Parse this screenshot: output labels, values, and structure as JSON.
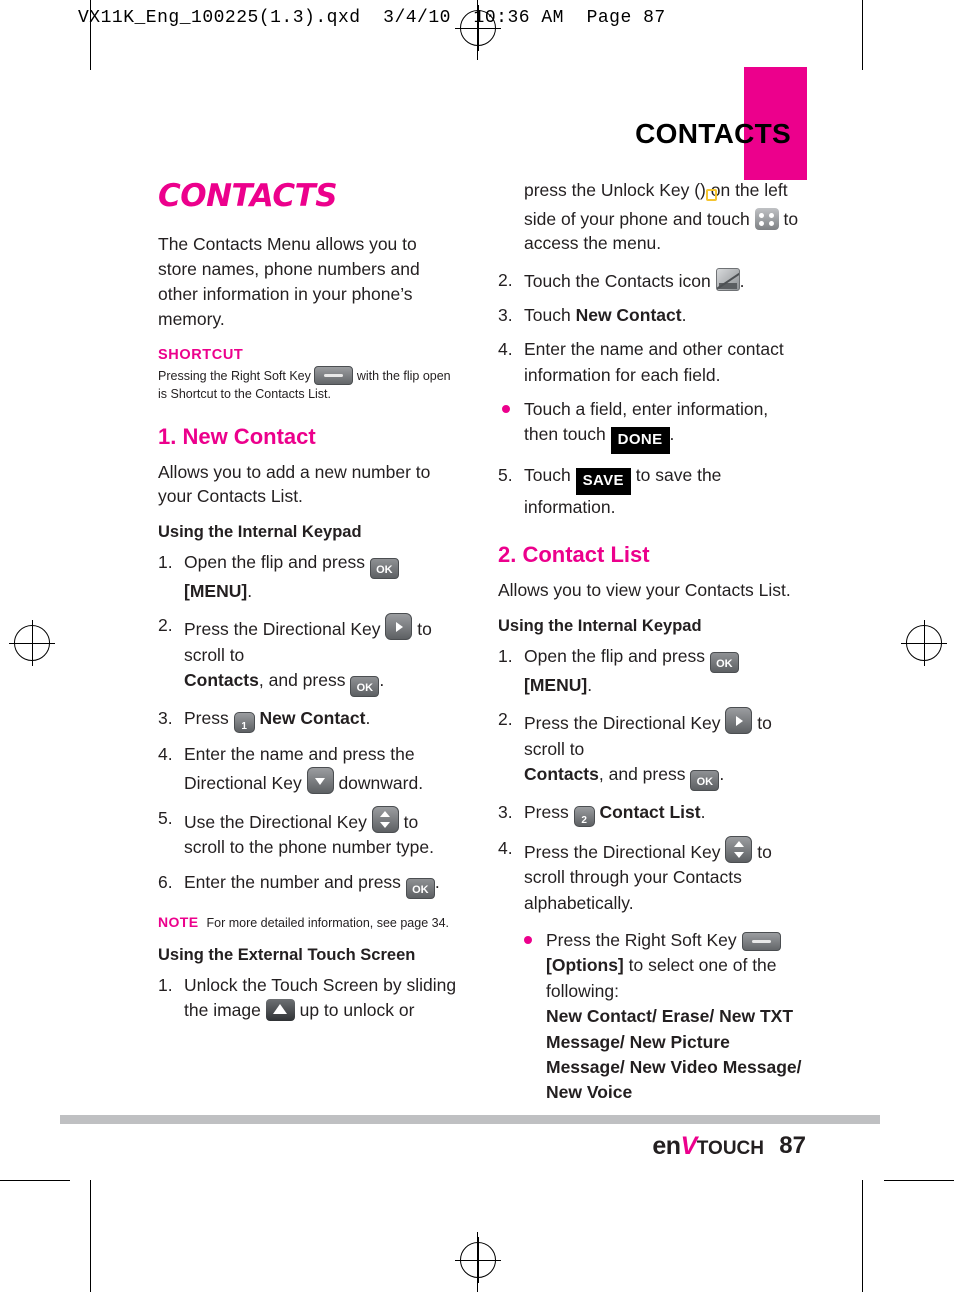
{
  "meta": {
    "slug": "VX11K_Eng_100225(1.3).qxd  3/4/10  10:36 AM  Page 87",
    "running_head": "CONTACTS",
    "page_number": "87",
    "brand": "enV",
    "brand_suffix": "TOUCH",
    "accent_color": "#ec008c"
  },
  "left_column": {
    "chapter_title": "CONTACTS",
    "intro": "The Contacts Menu allows you to store names, phone numbers and other information in your phone’s memory.",
    "shortcut_heading": "SHORTCUT",
    "shortcut_text_a": "Pressing the Right Soft Key",
    "shortcut_text_b": "with the flip open is Shortcut to the Contacts List.",
    "section1_title": "1. New Contact",
    "section1_body": "Allows you to add a new number to your Contacts List.",
    "internal_keypad_heading": "Using the Internal Keypad",
    "steps": [
      {
        "num": "1.",
        "a": "Open the flip and press",
        "b": "[MENU]",
        "c": "."
      },
      {
        "num": "2.",
        "a": "Press the Directional Key",
        "b": "to scroll to",
        "c": "Contacts",
        "d": ", and press",
        "e": "."
      },
      {
        "num": "3.",
        "a": "Press",
        "b": "New Contact",
        "c": "."
      },
      {
        "num": "4.",
        "a": "Enter the name and press the Directional Key",
        "b": "downward."
      },
      {
        "num": "5.",
        "a": "Use the Directional Key",
        "b": "to scroll to the phone number type."
      },
      {
        "num": "6.",
        "a": "Enter the number and press",
        "b": "."
      }
    ],
    "note_label": "NOTE",
    "note_text": "For more detailed information, see page 34.",
    "external_heading": "Using the External Touch Screen",
    "ext_step1_a": "Unlock the Touch Screen by sliding the image",
    "ext_step1_b": "up to unlock or"
  },
  "right_column": {
    "cont_a": "press the Unlock Key (",
    "cont_b": ") on the left side of your phone and touch",
    "cont_c": "to access the menu.",
    "steps": [
      {
        "num": "2.",
        "a": "Touch the Contacts icon",
        "b": "."
      },
      {
        "num": "3.",
        "a": "Touch",
        "b": "New Contact",
        "c": "."
      },
      {
        "num": "4.",
        "a": "Enter the name and other contact information for each field."
      }
    ],
    "bullet1_a": "Touch a field, enter information, then touch",
    "bullet1_key": "DONE",
    "bullet1_b": ".",
    "step5_num": "5.",
    "step5_a": "Touch",
    "step5_key": "SAVE",
    "step5_b": "to save the information.",
    "section2_title": "2. Contact List",
    "section2_body": "Allows you to view your Contacts List.",
    "internal_keypad_heading": "Using the Internal Keypad",
    "steps2": [
      {
        "num": "1.",
        "a": "Open the flip and press",
        "b": "[MENU]",
        "c": "."
      },
      {
        "num": "2.",
        "a": "Press the Directional Key",
        "b": "to scroll to",
        "c": "Contacts",
        "d": ", and press",
        "e": "."
      },
      {
        "num": "3.",
        "a": "Press",
        "b": "Contact List",
        "c": "."
      },
      {
        "num": "4.",
        "a": "Press the Directional Key",
        "b": "to scroll through your Contacts alphabetically."
      }
    ],
    "bullet2_a": "Press the Right Soft Key",
    "bullet2_b": "[Options]",
    "bullet2_c": "to select one of the following:",
    "bullet2_list": "New Contact/ Erase/ New TXT Message/ New Picture Message/ New Video Message/ New Voice"
  },
  "keys": {
    "ok": "OK",
    "num1": "1",
    "num2": "2",
    "done": "DONE",
    "save": "SAVE"
  }
}
